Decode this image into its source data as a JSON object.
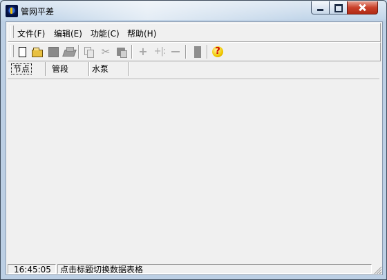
{
  "window": {
    "title": "管网平差"
  },
  "menu": {
    "items": [
      {
        "label": "文件(F)"
      },
      {
        "label": "编辑(E)"
      },
      {
        "label": "功能(C)"
      },
      {
        "label": "帮助(H)"
      }
    ]
  },
  "toolbar": {
    "icons": [
      "new-file-icon",
      "open-folder-icon",
      "save-icon",
      "print-icon",
      "copy-icon",
      "cut-icon",
      "paste-icon",
      "add-icon",
      "insert-icon",
      "remove-icon",
      "block-icon",
      "help-icon"
    ],
    "cut_glyph": "✂",
    "plus_glyph": "+",
    "insert_glyph": "+|:"
  },
  "tabs": {
    "items": [
      {
        "label": "节点",
        "active": true
      },
      {
        "label": "管段",
        "active": false
      },
      {
        "label": "水泵",
        "active": false
      }
    ]
  },
  "status": {
    "time": "16:45:05",
    "message": "点击标题切换数据表格"
  }
}
